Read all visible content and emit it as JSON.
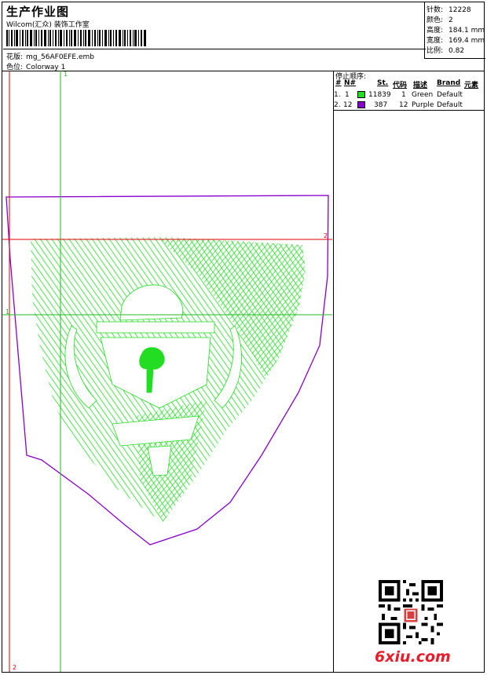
{
  "header": {
    "title": "生产作业图",
    "company": "Wilcom(汇众) 装饰工作室",
    "file_label": "花版:",
    "file_name": "mg_56AF0EFE.emb",
    "colorway_label": "色位:",
    "colorway": "Colorway 1"
  },
  "stats": [
    {
      "label": "针数:",
      "value": "12228"
    },
    {
      "label": "颜色:",
      "value": "2"
    },
    {
      "label": "高度:",
      "value": "184.1 mm"
    },
    {
      "label": "宽度:",
      "value": "169.4 mm"
    },
    {
      "label": "比例:",
      "value": "0.82"
    }
  ],
  "guides": {
    "vertical_top": "1",
    "horizontal_right": "2",
    "horizontal_left": "1",
    "vertical_bottom": "2"
  },
  "stop_sequence": {
    "title": "停止顺序:",
    "columns": [
      "#",
      "N#",
      "St.",
      "代码",
      "描述",
      "Brand",
      "元素"
    ],
    "rows": [
      {
        "index": "1.",
        "n": "1",
        "stitches": "11839",
        "code": "1",
        "description": "Green",
        "brand": "Default",
        "color": "#22dd22"
      },
      {
        "index": "2.",
        "n": "12",
        "stitches": "387",
        "code": "12",
        "description": "Purple",
        "brand": "Default",
        "color": "#8800cc"
      }
    ]
  },
  "colors": {
    "stitch_green": "#22dd22",
    "outline_purple": "#8800cc",
    "guide_red": "#e00000",
    "guide_green": "#22bb22"
  },
  "watermark": "6xiu.com"
}
